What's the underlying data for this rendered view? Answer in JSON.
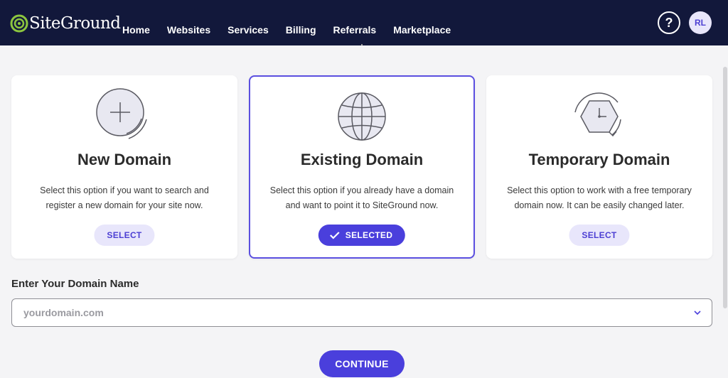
{
  "header": {
    "logo_text": "SiteGround",
    "nav": [
      "Home",
      "Websites",
      "Services",
      "Billing",
      "Referrals",
      "Marketplace"
    ],
    "help_icon": "question-circle-icon",
    "help_label": "?",
    "avatar_initials": "RL"
  },
  "cards": [
    {
      "title": "New Domain",
      "description": "Select this option if you want to search and register a new domain for your site now.",
      "button_label": "SELECT",
      "icon": "plus-circle-icon",
      "selected": false
    },
    {
      "title": "Existing Domain",
      "description": "Select this option if you already have a domain and want to point it to SiteGround now.",
      "button_label": "SELECTED",
      "icon": "globe-icon",
      "selected": true
    },
    {
      "title": "Temporary Domain",
      "description": "Select this option to work with a free temporary domain now. It can be easily changed later.",
      "button_label": "SELECT",
      "icon": "clock-refresh-icon",
      "selected": false
    }
  ],
  "domain_field": {
    "label": "Enter Your Domain Name",
    "placeholder": "yourdomain.com",
    "value": ""
  },
  "continue_label": "CONTINUE",
  "colors": {
    "header_bg": "#12183b",
    "accent": "#4a3fdc",
    "accent_light": "#e8e6fb",
    "logo_green": "#8cc63f"
  }
}
